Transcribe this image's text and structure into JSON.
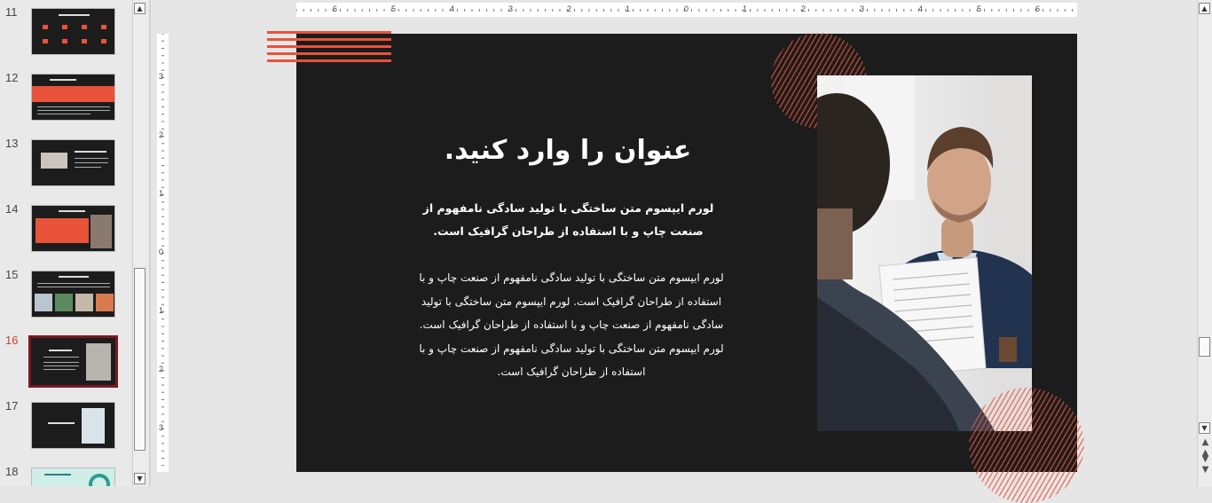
{
  "thumbnails": [
    {
      "number": "11",
      "selected": false
    },
    {
      "number": "12",
      "selected": false
    },
    {
      "number": "13",
      "selected": false
    },
    {
      "number": "14",
      "selected": false
    },
    {
      "number": "15",
      "selected": false
    },
    {
      "number": "16",
      "selected": true
    },
    {
      "number": "17",
      "selected": false
    },
    {
      "number": "18",
      "selected": false
    }
  ],
  "ruler": {
    "horizontal": [
      "6",
      "5",
      "4",
      "3",
      "2",
      "1",
      "0",
      "1",
      "2",
      "3",
      "4",
      "5",
      "6"
    ],
    "vertical": [
      "3",
      "2",
      "1",
      "0",
      "1",
      "2",
      "3"
    ]
  },
  "slide": {
    "title": "عنوان را وارد کنید.",
    "subtitle": "لورم ایپسوم متن ساختگی با تولید سادگی نامفهوم از صنعت چاپ و با استفاده از طراحان گرافیک است.",
    "body": "لورم ایپسوم متن ساختگی با تولید سادگی نامفهوم از صنعت چاپ و با استفاده از طراحان گرافیک است. لورم ایپسوم متن ساختگی با تولید سادگی نامفهوم از صنعت چاپ و با استفاده از طراحان گرافیک است. لورم ایپسوم متن ساختگی با تولید سادگی نامفهوم از صنعت چاپ و با استفاده از طراحان گرافیک است.",
    "background_color": "#1c1c1c",
    "accent_color": "#e8533a"
  },
  "icons": {
    "scroll_up": "triangle-up-icon",
    "scroll_down": "triangle-down-icon",
    "prev_slide": "double-up-icon",
    "next_slide": "double-down-icon"
  }
}
